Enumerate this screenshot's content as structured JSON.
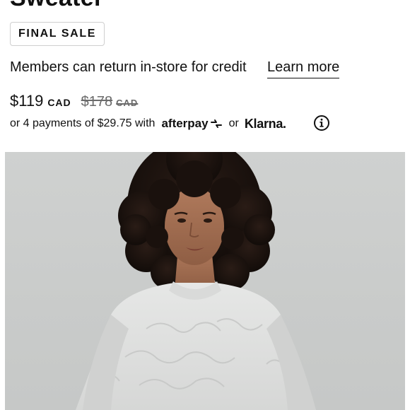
{
  "product": {
    "title": "Sweater",
    "badge": "FINAL SALE",
    "returns_text": "Members can return in-store for credit",
    "learn_more": "Learn more",
    "price": "$119",
    "currency": "CAD",
    "original_price": "$178",
    "original_currency": "CAD",
    "installments_text": "or 4 payments of $29.75 with",
    "afterpay_label": "afterpay",
    "or_text": "or",
    "klarna_label": "Klarna.",
    "info_icon": "info-circle-icon",
    "image_alt": "Model wearing a light grey quilted sweater"
  },
  "colors": {
    "text": "#111111",
    "muted": "#6b6b6b",
    "sweater": "#dfe0df",
    "background_photo": "#cbcdcc"
  }
}
